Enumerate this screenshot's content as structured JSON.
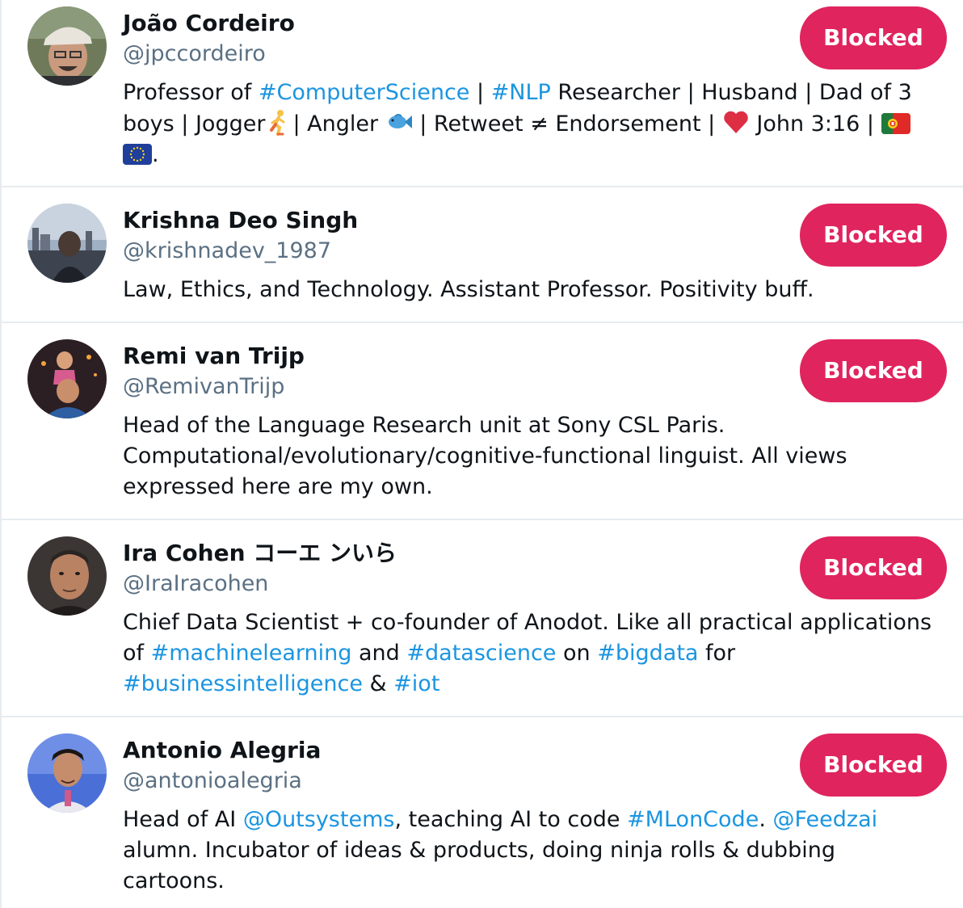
{
  "users": [
    {
      "name": "João Cordeiro",
      "handle": "@jpccordeiro",
      "button": "Blocked",
      "bio": {
        "l1_a": "Professor of ",
        "l1_b": "#ComputerScience",
        "l1_c": " | ",
        "l1_d": "#NLP",
        "l1_e": " Researcher | Husband | Dad of 3",
        "l2_a": "boys | Jogger",
        "l2_b": "| Angler ",
        "l2_c": " | Retweet ≠ Endorsement | ",
        "l2_d": " John 3:16 | ",
        "l3_a": "."
      },
      "emoji": [
        "runner-emoji",
        "fish-emoji",
        "heart-emoji",
        "portugal-flag",
        "eu-flag"
      ]
    },
    {
      "name": "Krishna Deo Singh",
      "handle": "@krishnadev_1987",
      "button": "Blocked",
      "bio": {
        "l1": "Law, Ethics, and Technology. Assistant Professor. Positivity buff."
      }
    },
    {
      "name": "Remi van Trijp",
      "handle": "@RemivanTrijp",
      "button": "Blocked",
      "bio": {
        "l1": "Head of the Language Research unit at Sony CSL Paris.",
        "l2": "Computational/evolutionary/cognitive-functional linguist. All views",
        "l3": "expressed here are my own."
      }
    },
    {
      "name": "Ira Cohen コーエ ンいら",
      "handle": "@IraIracohen",
      "button": "Blocked",
      "bio": {
        "l1": "Chief Data Scientist + co-founder of Anodot. Like all practical applications",
        "l2_a": "of ",
        "l2_b": "#machinelearning",
        "l2_c": " and ",
        "l2_d": "#datascience",
        "l2_e": " on ",
        "l2_f": "#bigdata",
        "l2_g": " for",
        "l3_a": "#businessintelligence",
        "l3_b": " & ",
        "l3_c": "#iot"
      }
    },
    {
      "name": "Antonio Alegria",
      "handle": "@antonioalegria",
      "button": "Blocked",
      "bio": {
        "l1_a": "Head of AI ",
        "l1_b": "@Outsystems",
        "l1_c": ", teaching AI to code ",
        "l1_d": "#MLonCode",
        "l1_e": ". ",
        "l1_f": "@Feedzai",
        "l2": "alumn. Incubator of ideas & products, doing ninja rolls & dubbing",
        "l3": "cartoons."
      }
    }
  ],
  "colors": {
    "blocked_button": "#e0245e",
    "link": "#1b95e0",
    "handle": "#5b7083",
    "divider": "#e6ecf0"
  }
}
